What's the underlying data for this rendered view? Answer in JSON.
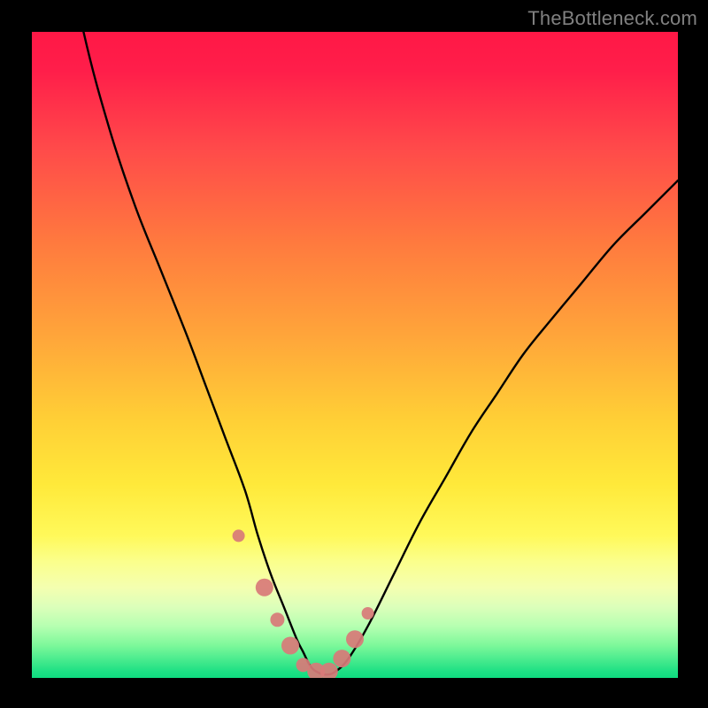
{
  "watermark": "TheBottleneck.com",
  "colors": {
    "background": "#000000",
    "gradient_top": "#ff1846",
    "gradient_bottom": "#0fdc80",
    "curve": "#000000",
    "marker": "#d87a78"
  },
  "chart_data": {
    "type": "line",
    "title": "",
    "xlabel": "",
    "ylabel": "",
    "xlim": [
      0,
      100
    ],
    "ylim": [
      0,
      100
    ],
    "series": [
      {
        "name": "bottleneck-curve",
        "x": [
          0,
          4,
          8,
          12,
          16,
          20,
          24,
          27,
          30,
          33,
          35,
          37,
          39,
          41,
          42,
          43,
          44,
          45.5,
          47,
          49,
          52,
          56,
          60,
          64,
          68,
          72,
          76,
          80,
          85,
          90,
          95,
          100
        ],
        "values": [
          140,
          120,
          100,
          85,
          73,
          63,
          53,
          45,
          37,
          29,
          22,
          16,
          11,
          6,
          4,
          2,
          1,
          0.5,
          1,
          3,
          8,
          16,
          24,
          31,
          38,
          44,
          50,
          55,
          61,
          67,
          72,
          77
        ]
      }
    ],
    "markers": {
      "name": "highlight-points",
      "x": [
        32,
        36,
        38,
        40,
        42,
        44,
        46,
        48,
        50,
        52
      ],
      "values": [
        22,
        14,
        9,
        5,
        2,
        1,
        1,
        3,
        6,
        10
      ],
      "sizes": [
        7,
        10,
        8,
        10,
        8,
        10,
        10,
        10,
        10,
        7
      ]
    }
  }
}
